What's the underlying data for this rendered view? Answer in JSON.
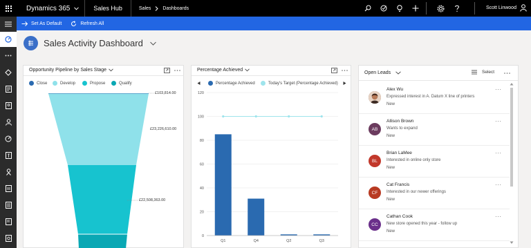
{
  "topbar": {
    "app_title": "Dynamics 365",
    "hub": "Sales Hub",
    "breadcrumb": [
      "Sales",
      "Dashboards"
    ],
    "user": "Scott Linwood"
  },
  "commands": {
    "set_default": "Set As Default",
    "refresh": "Refresh All"
  },
  "page": {
    "title": "Sales Activity Dashboard"
  },
  "pipeline": {
    "title": "Opportunity Pipeline by Sales Stage",
    "legend": [
      {
        "label": "Close",
        "color": "#2a6ab0"
      },
      {
        "label": "Develop",
        "color": "#8fe1ea"
      },
      {
        "label": "Propose",
        "color": "#17c3cf"
      },
      {
        "label": "Qualify",
        "color": "#0aa8b4"
      }
    ],
    "labels": [
      "£103,814.00",
      "£23,226,610.00",
      "£22,508,363.00"
    ]
  },
  "percentage": {
    "title": "Percentage Achieved",
    "legend": [
      {
        "label": "Percentage Achieved",
        "color": "#2a6ab0"
      },
      {
        "label": "Today's Target (Percentage Achieved)",
        "color": "#9ee4ec"
      }
    ]
  },
  "chart_data": {
    "type": "bar",
    "categories": [
      "Q1",
      "Q4",
      "Q2",
      "Q3"
    ],
    "series": [
      {
        "name": "Percentage Achieved",
        "values": [
          85,
          31,
          1,
          1
        ]
      },
      {
        "name": "Today's Target (Percentage Achieved)",
        "values": [
          100,
          100,
          100,
          100
        ]
      }
    ],
    "yticks": [
      0,
      20,
      40,
      60,
      80,
      100,
      120
    ],
    "ylim": [
      0,
      120
    ],
    "grid": true,
    "legend_position": "top"
  },
  "leads": {
    "title": "Open Leads",
    "select_label": "Select",
    "items": [
      {
        "name": "Alex Wu",
        "topic": "Expressed interest in A. Datum X line of printers",
        "status": "New",
        "initials": "",
        "color": "#8a5a3b",
        "photo": true
      },
      {
        "name": "Allison Brown",
        "topic": "Wants to expand",
        "status": "New",
        "initials": "AB",
        "color": "#6b3b5e"
      },
      {
        "name": "Brian LaMee",
        "topic": "Interested in online only store",
        "status": "New",
        "initials": "BL",
        "color": "#c2382b"
      },
      {
        "name": "Cat Francis",
        "topic": "Interested in our newer offerings",
        "status": "New",
        "initials": "CF",
        "color": "#b83a22"
      },
      {
        "name": "Cathan Cook",
        "topic": "New store opened this year - follow up",
        "status": "New",
        "initials": "CC",
        "color": "#6a2f8a"
      }
    ]
  }
}
